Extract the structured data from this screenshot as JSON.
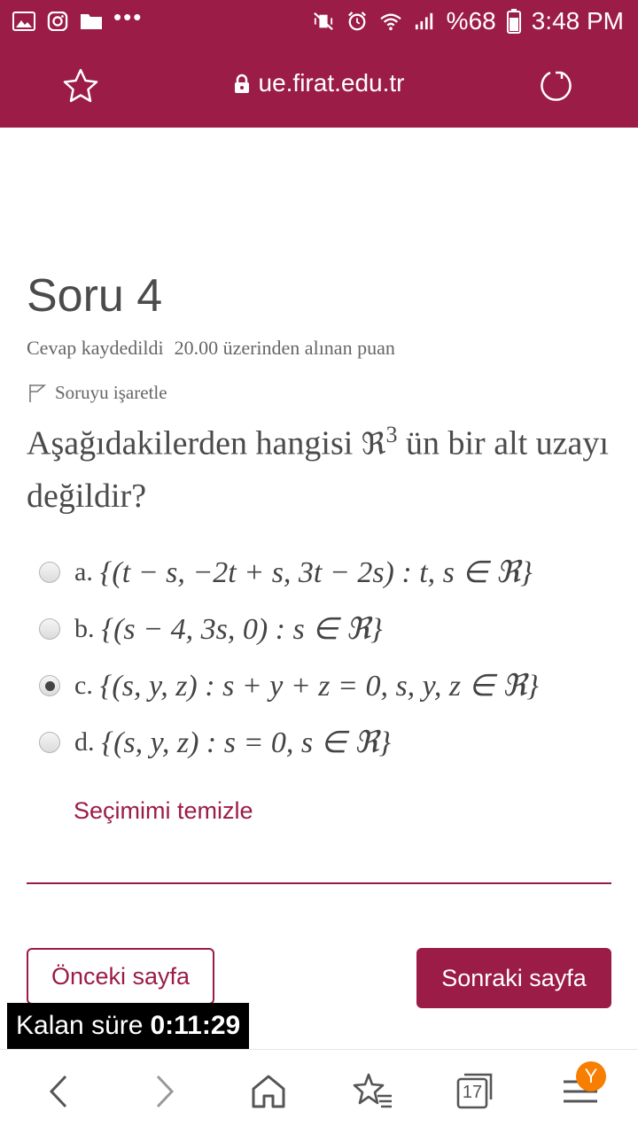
{
  "status_bar": {
    "battery_percent": "%68",
    "time": "3:48 PM",
    "left_icons": [
      "image-icon",
      "instagram-icon",
      "folder-icon",
      "more-dots-icon"
    ],
    "right_icons": [
      "mute-vibrate-icon",
      "alarm-icon",
      "wifi-icon",
      "signal-icon",
      "battery-icon"
    ]
  },
  "browser": {
    "url": "ue.firat.edu.tr",
    "icons": [
      "star-icon",
      "lock-icon",
      "refresh-icon"
    ]
  },
  "question": {
    "title": "Soru 4",
    "status": "Cevap kaydedildi",
    "points": "20.00 üzerinden alınan puan",
    "flag_label": "Soruyu işaretle",
    "text_before": "Aşağıdakilerden hangisi",
    "symbol": "ℜ",
    "exponent": "3",
    "text_after": " ün bir alt uzayı değildir?"
  },
  "options": [
    {
      "letter": "a.",
      "math": "{(t − s, −2t + s, 3t − 2s) : t, s ∈ ℜ}",
      "selected": false
    },
    {
      "letter": "b.",
      "math": "{(s − 4, 3s, 0) : s ∈ ℜ}",
      "selected": false
    },
    {
      "letter": "c.",
      "math": "{(s, y, z) : s + y + z = 0, s, y, z ∈ ℜ}",
      "selected": true
    },
    {
      "letter": "d.",
      "math": "{(s, y, z) : s = 0, s ∈ ℜ}",
      "selected": false
    }
  ],
  "actions": {
    "clear_selection": "Seçimimi temizle",
    "previous_page": "Önceki sayfa",
    "next_page": "Sonraki sayfa"
  },
  "timer": {
    "label": "Kalan süre",
    "value": "0:11:29"
  },
  "bottom_nav": {
    "tab_count": "17",
    "profile_badge": "Y",
    "icons": [
      "back-icon",
      "forward-icon",
      "home-icon",
      "bookmarks-icon",
      "tabs-icon",
      "menu-icon"
    ]
  },
  "colors": {
    "brand": "#9b1c46",
    "badge": "#f77e00"
  }
}
